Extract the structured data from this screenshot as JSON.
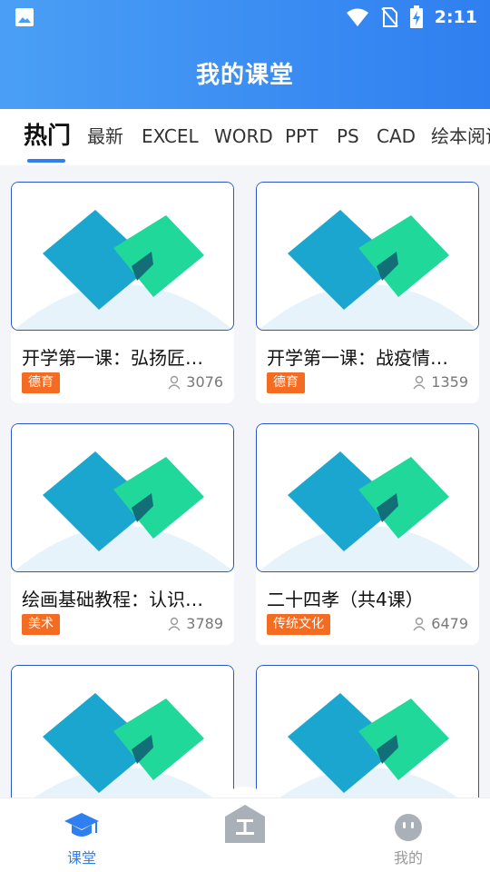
{
  "status_bar": {
    "time": "2:11"
  },
  "header": {
    "title": "我的课堂"
  },
  "tabs": [
    {
      "label": "热门",
      "active": true
    },
    {
      "label": "最新"
    },
    {
      "label": "EXCEL"
    },
    {
      "label": "WORD"
    },
    {
      "label": "PPT"
    },
    {
      "label": "PS"
    },
    {
      "label": "CAD"
    },
    {
      "label": "绘本阅读"
    }
  ],
  "courses": [
    {
      "title": "开学第一课：弘扬匠…",
      "tag": "德育",
      "count": "3076"
    },
    {
      "title": "开学第一课：战疫情…",
      "tag": "德育",
      "count": "1359"
    },
    {
      "title": "绘画基础教程：认识…",
      "tag": "美术",
      "count": "3789"
    },
    {
      "title": "二十四孝（共4课）",
      "tag": "传统文化",
      "count": "6479"
    },
    {
      "title": "",
      "tag": "",
      "count": ""
    },
    {
      "title": "",
      "tag": "",
      "count": ""
    }
  ],
  "bottom_nav": {
    "items": [
      {
        "label": "课堂",
        "icon": "graduation-cap-icon",
        "active": true
      },
      {
        "label": "",
        "icon": "workshop-icon"
      },
      {
        "label": "我的",
        "icon": "face-icon"
      }
    ]
  },
  "colors": {
    "primary": "#2f7ff0",
    "tag": "#f36c21",
    "inactive": "#aab0b8"
  }
}
